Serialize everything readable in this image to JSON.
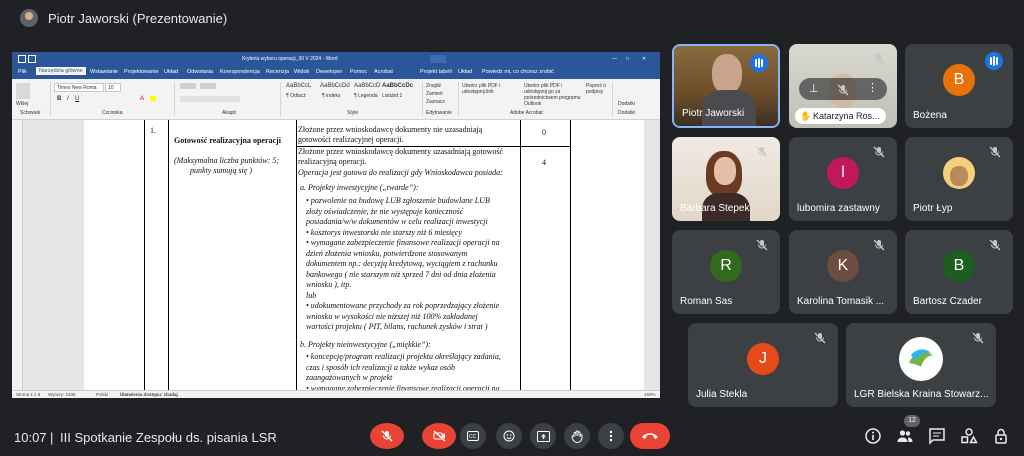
{
  "header": {
    "presenter": "Piotr Jaworski (Prezentowanie)"
  },
  "word": {
    "title": "Kryteria wyboru operacji_30 V 2024 - Word",
    "tabs": [
      "Plik",
      "Narzędzia główne",
      "Wstawianie",
      "Projektowanie",
      "Układ",
      "Odwołania",
      "Korespondencja",
      "Recenzja",
      "Widok",
      "Deweloper",
      "Pomoc",
      "Acrobat",
      "Projekt tabeli",
      "Układ"
    ],
    "tell_me": "Powiedz mi, co chcesz zrobić",
    "font_name": "Times New Roma",
    "font_size": "10",
    "paste_label": "Wklej",
    "styles": [
      {
        "preview": "AaBbCcL",
        "name": "¶ Odtacż"
      },
      {
        "preview": "AaBbCcDd",
        "name": "¶ indeks"
      },
      {
        "preview": "AaBbCcD",
        "name": "¶ Legenda"
      },
      {
        "preview": "AaBbCcDc",
        "name": "Listubd 1"
      }
    ],
    "editing": [
      "Znajdź",
      "Zamień",
      "Zaznacz"
    ],
    "acrobat": [
      "Utwórz plik PDF i udostępnij link",
      "Utwórz plik PDF i udostępnij go za pośrednictwem programu Outlook",
      "Poproś o podpisy"
    ],
    "dictate": "Dodatki",
    "groups": [
      "Schowek",
      "Czcionka",
      "Akapit",
      "Style",
      "Edytowanie",
      "Adobe Acrobat",
      "Dodatki"
    ],
    "doc": {
      "num": "1.",
      "criterion_title": "Gotowość realizacyjna operacji",
      "criterion_note_1": "(Maksymalna liczba punktów: 5;",
      "criterion_note_2": "punkty sumują się )",
      "row1_line1": "Złożone przez wnioskodawcę dokumenty nie uzasadniają",
      "row1_line2": "gotowości realizacyjnej operacji.",
      "row1_points": "0",
      "row2_line1": "Złożone przez wnioskodawcę dokumenty uzasadniają gotowość",
      "row2_line2": "realizacyjną operacji.",
      "row2_line3": "Operacja jest gotowa do realizacji gdy Wnioskodawca posiada:",
      "row2_points": "4",
      "section_a": "a.   Projekty inwestycyjne („twarde”):",
      "a_items": [
        "•  pozwolenie na budowę LUB zgłoszenie budowlane LUB",
        "   złoży oświadczenie, że nie występuje konieczność",
        "   posiadania/w/w dokumentów w celu realizacji inwestycji",
        "•  kosztorys inwestorski nie starszy niż 6 miesięcy",
        "•  wymagane zabezpieczenie finansowe realizacji operacji na",
        "   dzień złożenia wniosku, potwierdzone stosowanym",
        "   dokumentem np.: decyzją kredytową, wyciągiem z rachunku",
        "   bankowego ( nie starszym niż sprzed 7 dni  od dnia złożenia",
        "   wniosku ), itp.",
        "   lub",
        "•  udokumentowane przychody za rok poprzedzający złożenie",
        "   wniosku w wysokości nie niższej niż 100% zakładanej",
        "   wartości projektu ( PIT, bilans, rachunek zysków i strat )"
      ],
      "section_b": "b.   Projekty nieinwestycyjne („miękkie”):",
      "b_items": [
        "•  koncepcję/program realizacji projektu określający zadania,",
        "   czas i sposób ich realizacji a także wykaz osób",
        "   zaangażowanych w projekt",
        "•  wymagane zabezpieczenie finansowe realizacji operacji na"
      ]
    },
    "status": {
      "page": "Strona 1 z 8",
      "words": "Wyrazy: 1535",
      "lang": "Polski",
      "access": "Ułatwienia dostępu: zbadaj",
      "zoom": "150%"
    }
  },
  "participants": [
    {
      "name": "Piotr Jaworski",
      "type": "video",
      "speaking": true
    },
    {
      "name": "Katarzyna Ros...",
      "type": "video",
      "muted": true,
      "hand_raised": true
    },
    {
      "name": "Bożena",
      "initial": "B",
      "color": "#e8710a",
      "speaking": true
    },
    {
      "name": "Barbara Stepek",
      "type": "video",
      "muted": true
    },
    {
      "name": "lubomira zastawny",
      "initial": "l",
      "color": "#c2185b",
      "muted": true
    },
    {
      "name": "Piotr Łyp",
      "type": "avatar",
      "muted": true
    },
    {
      "name": "Roman Sas",
      "initial": "R",
      "color": "#33691e",
      "muted": true
    },
    {
      "name": "Karolina Tomasik ...",
      "initial": "K",
      "color": "#6d4c41",
      "muted": true
    },
    {
      "name": "Bartosz Czader",
      "initial": "B",
      "color": "#1b5e20",
      "muted": true
    },
    {
      "name": "Julia Stekla",
      "initial": "J",
      "color": "#e64a19",
      "muted": true
    },
    {
      "name": "LGR Bielska Kraina Stowarz...",
      "type": "logo",
      "muted": true
    }
  ],
  "footer": {
    "time": "10:07",
    "separator": "|",
    "meeting_title": "III Spotkanie Zespołu ds. pisania LSR",
    "participant_count": "12"
  }
}
